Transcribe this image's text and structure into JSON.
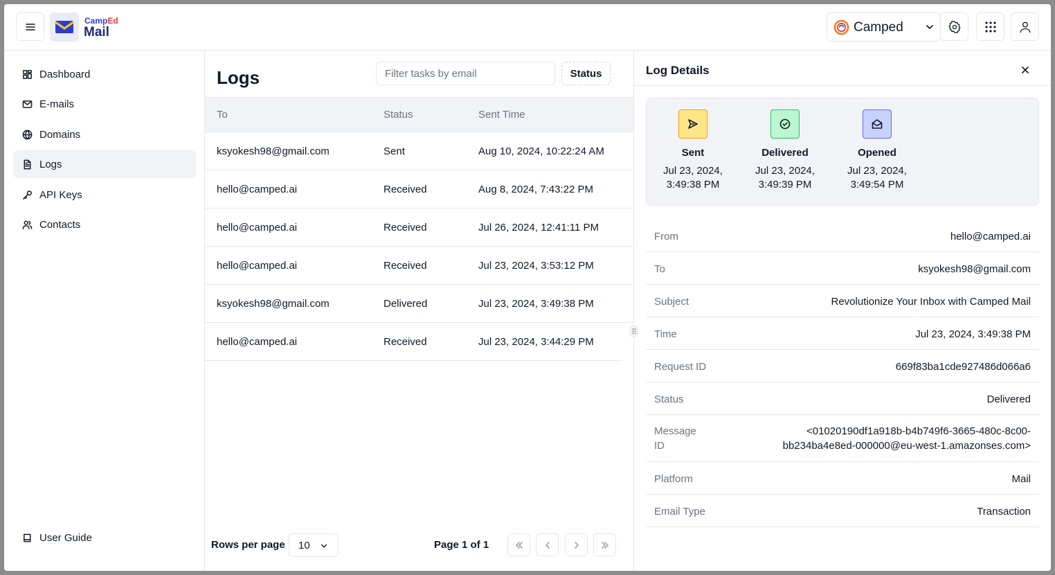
{
  "brand": {
    "small_a": "Camp",
    "small_b": "Ed",
    "big": "Mail"
  },
  "org": {
    "name": "Camped"
  },
  "sidebar": {
    "items": [
      {
        "label": "Dashboard",
        "icon": "grid-icon"
      },
      {
        "label": "E-mails",
        "icon": "mail-icon"
      },
      {
        "label": "Domains",
        "icon": "globe-icon"
      },
      {
        "label": "Logs",
        "icon": "file-text-icon",
        "active": true
      },
      {
        "label": "API Keys",
        "icon": "key-icon"
      },
      {
        "label": "Contacts",
        "icon": "users-icon"
      }
    ],
    "bottom": {
      "label": "User Guide",
      "icon": "book-icon"
    }
  },
  "logs": {
    "title": "Logs",
    "filter_placeholder": "Filter tasks by email",
    "status_button": "Status",
    "columns": [
      "To",
      "Status",
      "Sent Time"
    ],
    "rows": [
      [
        "ksyokesh98@gmail.com",
        "Sent",
        "Aug 10, 2024, 10:22:24 AM"
      ],
      [
        "hello@camped.ai",
        "Received",
        "Aug 8, 2024, 7:43:22 PM"
      ],
      [
        "hello@camped.ai",
        "Received",
        "Jul 26, 2024, 12:41:11 PM"
      ],
      [
        "hello@camped.ai",
        "Received",
        "Jul 23, 2024, 3:53:12 PM"
      ],
      [
        "ksyokesh98@gmail.com",
        "Delivered",
        "Jul 23, 2024, 3:49:38 PM"
      ],
      [
        "hello@camped.ai",
        "Received",
        "Jul 23, 2024, 3:44:29 PM"
      ]
    ],
    "rows_per_page_label": "Rows per page",
    "rows_per_page_value": "10",
    "page_info": "Page 1 of 1"
  },
  "details": {
    "title": "Log Details",
    "timeline": [
      {
        "label": "Sent",
        "time_line1": "Jul 23, 2024,",
        "time_line2": "3:49:38 PM",
        "color": "#fde68a",
        "border": "#f59e0b",
        "icon": "send-icon"
      },
      {
        "label": "Delivered",
        "time_line1": "Jul 23, 2024,",
        "time_line2": "3:49:39 PM",
        "color": "#bbf7d0",
        "border": "#22c55e",
        "icon": "check-circle-icon"
      },
      {
        "label": "Opened",
        "time_line1": "Jul 23, 2024,",
        "time_line2": "3:49:54 PM",
        "color": "#c7d2fe",
        "border": "#6366f1",
        "icon": "mail-open-icon"
      }
    ],
    "fields": [
      {
        "key": "From",
        "value": "hello@camped.ai"
      },
      {
        "key": "To",
        "value": "ksyokesh98@gmail.com"
      },
      {
        "key": "Subject",
        "value": "Revolutionize Your Inbox with Camped Mail"
      },
      {
        "key": "Time",
        "value": "Jul 23, 2024, 3:49:38 PM"
      },
      {
        "key": "Request ID",
        "value": "669f83ba1cde927486d066a6"
      },
      {
        "key": "Status",
        "value": "Delivered"
      },
      {
        "key_line1": "Message",
        "key_line2": "ID",
        "value_line1": "<01020190df1a918b-b4b749f6-3665-480c-8c00-",
        "value_line2": "bb234ba4e8ed-000000@eu-west-1.amazonses.com>"
      },
      {
        "key": "Platform",
        "value": "Mail"
      },
      {
        "key": "Email Type",
        "value": "Transaction"
      }
    ]
  }
}
